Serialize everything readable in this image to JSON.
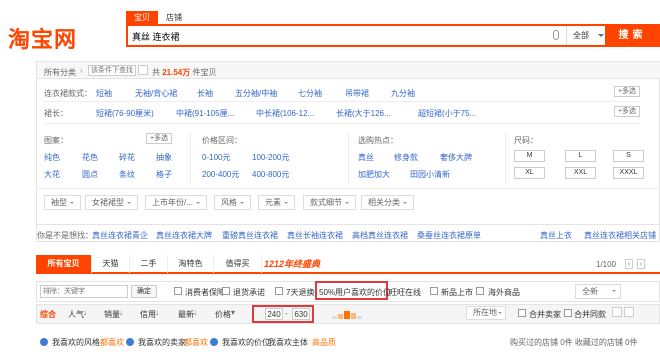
{
  "header": {
    "logo": "淘宝网",
    "tabs": [
      "宝贝",
      "店铺"
    ],
    "search_value": "真丝 连衣裙",
    "scope": "全部",
    "search_btn": "搜索"
  },
  "crumbs": {
    "all": "所有分类",
    "filter_placeholder": "该条件下查找",
    "count_prefix": "共",
    "count_value": "21.54万",
    "count_suffix": "件宝贝"
  },
  "style_row": {
    "label": "连衣裙款式：",
    "items": [
      "短袖",
      "无袖/背心裙",
      "长袖",
      "五分袖/中袖",
      "七分袖",
      "吊带裙",
      "九分袖"
    ],
    "more": "+多选"
  },
  "length_row": {
    "label": "裙长：",
    "items": [
      "短裙(76-90厘米)",
      "中裙(91-105厘...",
      "中长裙(106-12...",
      "长裙(大于126...",
      "超短裙(小于75..."
    ],
    "more": "+多选"
  },
  "pattern": {
    "label": "图案：",
    "more": "+多选",
    "items": [
      "纯色",
      "花色",
      "碎花",
      "抽象",
      "大花",
      "圆点",
      "条纹",
      "格子"
    ]
  },
  "price": {
    "label": "价格区间：",
    "items": [
      "0-100元",
      "100-200元",
      "200-400元",
      "400-800元"
    ]
  },
  "hot": {
    "label": "选购热点：",
    "items": [
      "真丝",
      "修身款",
      "奢侈大牌",
      "加肥加大",
      "田园小清新"
    ]
  },
  "size": {
    "label": "尺码：",
    "items": [
      "M",
      "L",
      "S",
      "XL",
      "XXL",
      "XXXL"
    ]
  },
  "dropdowns": [
    "袖型",
    "女裙裙型",
    "上市年份/...",
    "风格",
    "元素",
    "款式细节",
    "相关分类"
  ],
  "suggest": {
    "title": "你是不是想找：",
    "items": [
      "真丝连衣裙青企",
      "真丝连衣裙大牌",
      "重磅真丝连衣裙",
      "真丝长袖连衣裙",
      "高档真丝连衣裙",
      "桑蚕丝连衣裙原单",
      "真丝上衣",
      "真丝连衣裙相关店铺"
    ]
  },
  "tabbar": {
    "tabs": [
      "所有宝贝",
      "天猫",
      "二手",
      "淘特色",
      "值得买"
    ],
    "promo": "1212年终盛典",
    "pager": "1/100"
  },
  "filterbar": {
    "placeholder": "排除：关键字",
    "confirm": "确定",
    "options": [
      "消费者保障",
      "退货承诺",
      "7天退换",
      "50%用户喜欢的价位",
      "旺旺在线",
      "新品上市",
      "海外商品"
    ],
    "select": "全新"
  },
  "sortbar": {
    "items": [
      "综合",
      "人气",
      "销量",
      "信用",
      "最新",
      "价格"
    ],
    "price_from": "240",
    "price_to": "630",
    "location": "所在地",
    "merge_seller": "合并卖家",
    "merge_same": "合并同款"
  },
  "bottom": {
    "items": [
      "我喜欢的风格",
      "都喜欢",
      "我喜欢的卖家",
      "都喜欢",
      "我喜欢的价位",
      "我喜欢主体",
      "高品质"
    ],
    "right": "购买过的店铺 0件  收藏过的店铺 0件"
  },
  "colors": {
    "accent": "#ff4400",
    "link": "#3366cc",
    "highlight": "#e4393c"
  }
}
